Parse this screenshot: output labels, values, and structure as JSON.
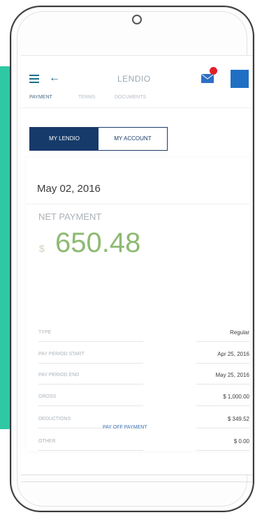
{
  "header": {
    "brand": "LENDIO",
    "badge_color": "#e0202b",
    "accent": "#1f6fc4"
  },
  "tabs": [
    {
      "label": "PAYMENT",
      "active": true
    },
    {
      "label": "TERMS",
      "active": false
    },
    {
      "label": "DOCUMENTS",
      "active": false
    }
  ],
  "toggle": {
    "left": "MY LENDIO",
    "right": "MY ACCOUNT"
  },
  "card": {
    "date": "May 02, 2016",
    "net_label": "NET PAYMENT",
    "currency": "$",
    "amount": "650.48",
    "rows": [
      {
        "label": "TYPE",
        "value": "Regular"
      },
      {
        "label": "PAY PERIOD START",
        "value": "Apr 25, 2016"
      },
      {
        "label": "PAY PERIOD END",
        "value": "May 25, 2016"
      },
      {
        "label": "GROSS",
        "value": "$ 1,000.00"
      },
      {
        "label": "DEDUCTIONS",
        "value": "$ 349.52"
      },
      {
        "label": "OTHER",
        "value": "$ 0.00"
      }
    ]
  },
  "footer": {
    "pay_link": "PAY OFF PAYMENT"
  },
  "colors": {
    "teal": "#2ec9a4",
    "navy": "#163a6a",
    "amount_green": "#8dba72"
  }
}
